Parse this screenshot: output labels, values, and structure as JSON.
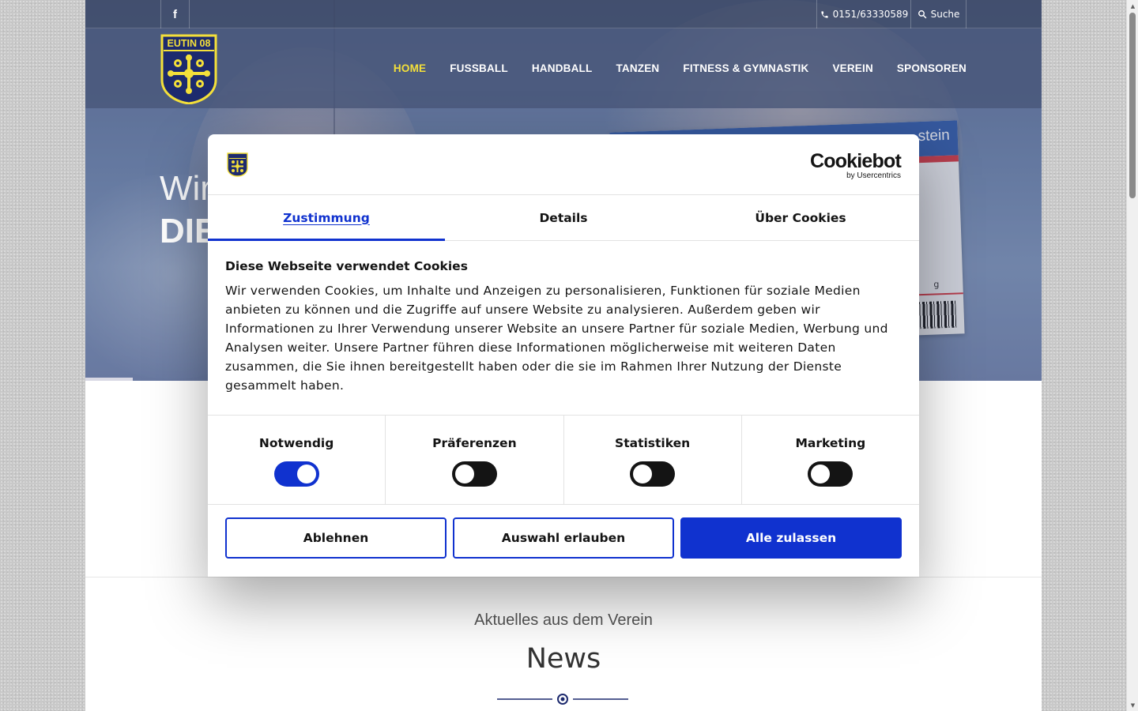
{
  "topbar": {
    "facebook_icon": "facebook-icon",
    "phone": "0151/63330589",
    "phone_icon": "phone-icon",
    "search_label": "Suche",
    "search_icon": "search-icon"
  },
  "logo": {
    "text": "EUTIN 08",
    "colors": {
      "blue": "#1d2a6e",
      "yellow": "#f4e03a"
    }
  },
  "nav": {
    "items": [
      {
        "label": "HOME",
        "active": true
      },
      {
        "label": "FUSSBALL"
      },
      {
        "label": "HANDBALL"
      },
      {
        "label": "TANZEN"
      },
      {
        "label": "FITNESS & GYMNASTIK"
      },
      {
        "label": "VEREIN"
      },
      {
        "label": "SPONSOREN"
      }
    ],
    "active_color": "#f4e03a"
  },
  "hero": {
    "line1": "Wir",
    "line2": "DIE",
    "card_word": "stein",
    "card_small": "g"
  },
  "news": {
    "kicker": "Aktuelles aus dem Verein",
    "title": "News",
    "ornament_color": "#1d2a6e"
  },
  "cookie_dialog": {
    "brand": "Cookiebot",
    "brand_sub": "by Usercentrics",
    "tabs": [
      {
        "label": "Zustimmung",
        "active": true
      },
      {
        "label": "Details"
      },
      {
        "label": "Über Cookies"
      }
    ],
    "body_title": "Diese Webseite verwendet Cookies",
    "body_text": "Wir verwenden Cookies, um Inhalte und Anzeigen zu personalisieren, Funktionen für soziale Medien anbieten zu können und die Zugriffe auf unsere Website zu analysieren. Außerdem geben wir Informationen zu Ihrer Verwendung unserer Website an unsere Partner für soziale Medien, Werbung und Analysen weiter. Unsere Partner führen diese Informationen möglicherweise mit weiteren Daten zusammen, die Sie ihnen bereitgestellt haben oder die sie im Rahmen Ihrer Nutzung der Dienste gesammelt haben.",
    "toggles": [
      {
        "label": "Notwendig",
        "on": true
      },
      {
        "label": "Präferenzen",
        "on": false
      },
      {
        "label": "Statistiken",
        "on": false
      },
      {
        "label": "Marketing",
        "on": false
      }
    ],
    "buttons": {
      "decline": "Ablehnen",
      "allow_selection": "Auswahl erlauben",
      "allow_all": "Alle zulassen"
    },
    "accent_color": "#1032cf"
  }
}
